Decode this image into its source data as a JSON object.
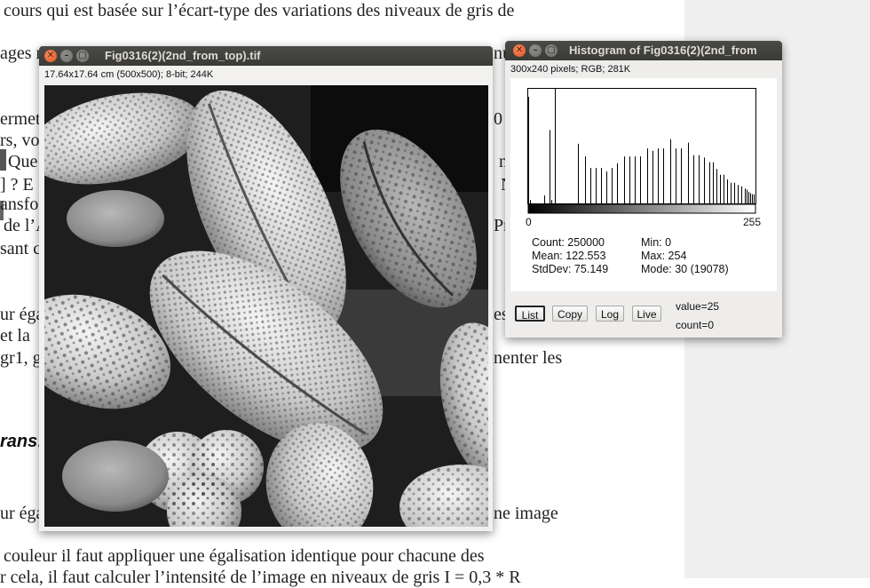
{
  "document": {
    "lines": [
      "cours qui est basée sur l’écart-type des variations des niveaux de gris de",
      "ages n",
      "ermet",
      "rs, vo",
      "Que",
      "] ? E",
      "ansfo",
      "de l’A",
      "sant c",
      "ur éga",
      "et la",
      "gr1, g",
      "ur éga",
      "couleur il faut appliquer une égalisation identique pour chacune des",
      "r cela, il faut calculer l’intensité de l’image en niveaux de gris I = 0,3 * R"
    ],
    "right_fragments": [
      "nu",
      "0",
      "n",
      "N",
      "Pro",
      "es",
      "nenter les",
      "ne image"
    ],
    "heading": "rans",
    "heading_suffix": ":"
  },
  "image_window": {
    "title": "Fig0316(2)(2nd_from_top).tif",
    "info": "17.64x17.64 cm (500x500); 8-bit; 244K"
  },
  "histogram_window": {
    "title": "Histogram of Fig0316(2)(2nd_from",
    "info": "300x240 pixels; RGB; 281K",
    "axis_min_label": "0",
    "axis_max_label": "255",
    "stats": {
      "count": "Count: 250000",
      "mean": "Mean: 122.553",
      "stddev": "StdDev: 75.149",
      "min": "Min: 0",
      "max": "Max: 254",
      "mode": "Mode: 30 (19078)"
    },
    "buttons": {
      "list": "List",
      "copy": "Copy",
      "log": "Log",
      "live": "Live"
    },
    "value_readout": "value=25",
    "count_readout": "count=0",
    "colors": {
      "bars": "#000000",
      "frame": "#000000",
      "gradient_start": "#000000",
      "gradient_end": "#ffffff"
    }
  },
  "chart_data": {
    "type": "bar",
    "title": "",
    "xlabel": "",
    "ylabel": "",
    "xlim": [
      0,
      255
    ],
    "x": [
      0,
      2,
      18,
      24,
      26,
      30,
      56,
      64,
      70,
      76,
      82,
      88,
      94,
      100,
      108,
      114,
      120,
      126,
      134,
      140,
      146,
      152,
      160,
      166,
      172,
      180,
      186,
      192,
      198,
      204,
      208,
      212,
      216,
      220,
      224,
      228,
      232,
      236,
      240,
      244,
      246,
      248,
      250,
      252,
      254
    ],
    "values": [
      0.93,
      0.03,
      0.07,
      0.64,
      0.03,
      1.0,
      0.52,
      0.41,
      0.31,
      0.31,
      0.31,
      0.28,
      0.31,
      0.35,
      0.41,
      0.41,
      0.41,
      0.41,
      0.48,
      0.46,
      0.48,
      0.48,
      0.56,
      0.48,
      0.48,
      0.53,
      0.42,
      0.42,
      0.4,
      0.36,
      0.36,
      0.3,
      0.25,
      0.25,
      0.21,
      0.18,
      0.18,
      0.16,
      0.15,
      0.13,
      0.12,
      0.1,
      0.09,
      0.08,
      0.08
    ]
  }
}
